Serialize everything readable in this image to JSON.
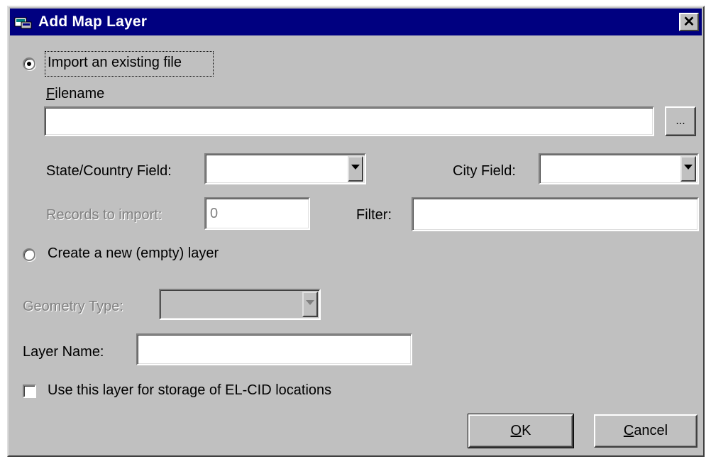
{
  "window": {
    "title": "Add Map Layer",
    "close_label": "✕"
  },
  "import_option": {
    "label": "Import an existing file",
    "selected": true
  },
  "filename": {
    "label_mnemonic": "F",
    "label_rest": "ilename",
    "value": "",
    "browse_label": "..."
  },
  "state_country": {
    "label": "State/Country Field:",
    "value": ""
  },
  "city": {
    "label": "City Field:",
    "value": ""
  },
  "records": {
    "label": "Records to import:",
    "value": "0"
  },
  "filter": {
    "label": "Filter:",
    "value": ""
  },
  "create_option": {
    "label": "Create a new (empty) layer",
    "selected": false
  },
  "geometry_type": {
    "label": "Geometry Type:",
    "value": ""
  },
  "layer_name": {
    "label": "Layer Name:",
    "value": ""
  },
  "storage_option": {
    "label": "Use this layer for storage of EL-CID locations",
    "checked": false
  },
  "buttons": {
    "ok_mnemonic": "O",
    "ok_rest": "K",
    "cancel_mnemonic": "C",
    "cancel_rest": "ancel"
  }
}
